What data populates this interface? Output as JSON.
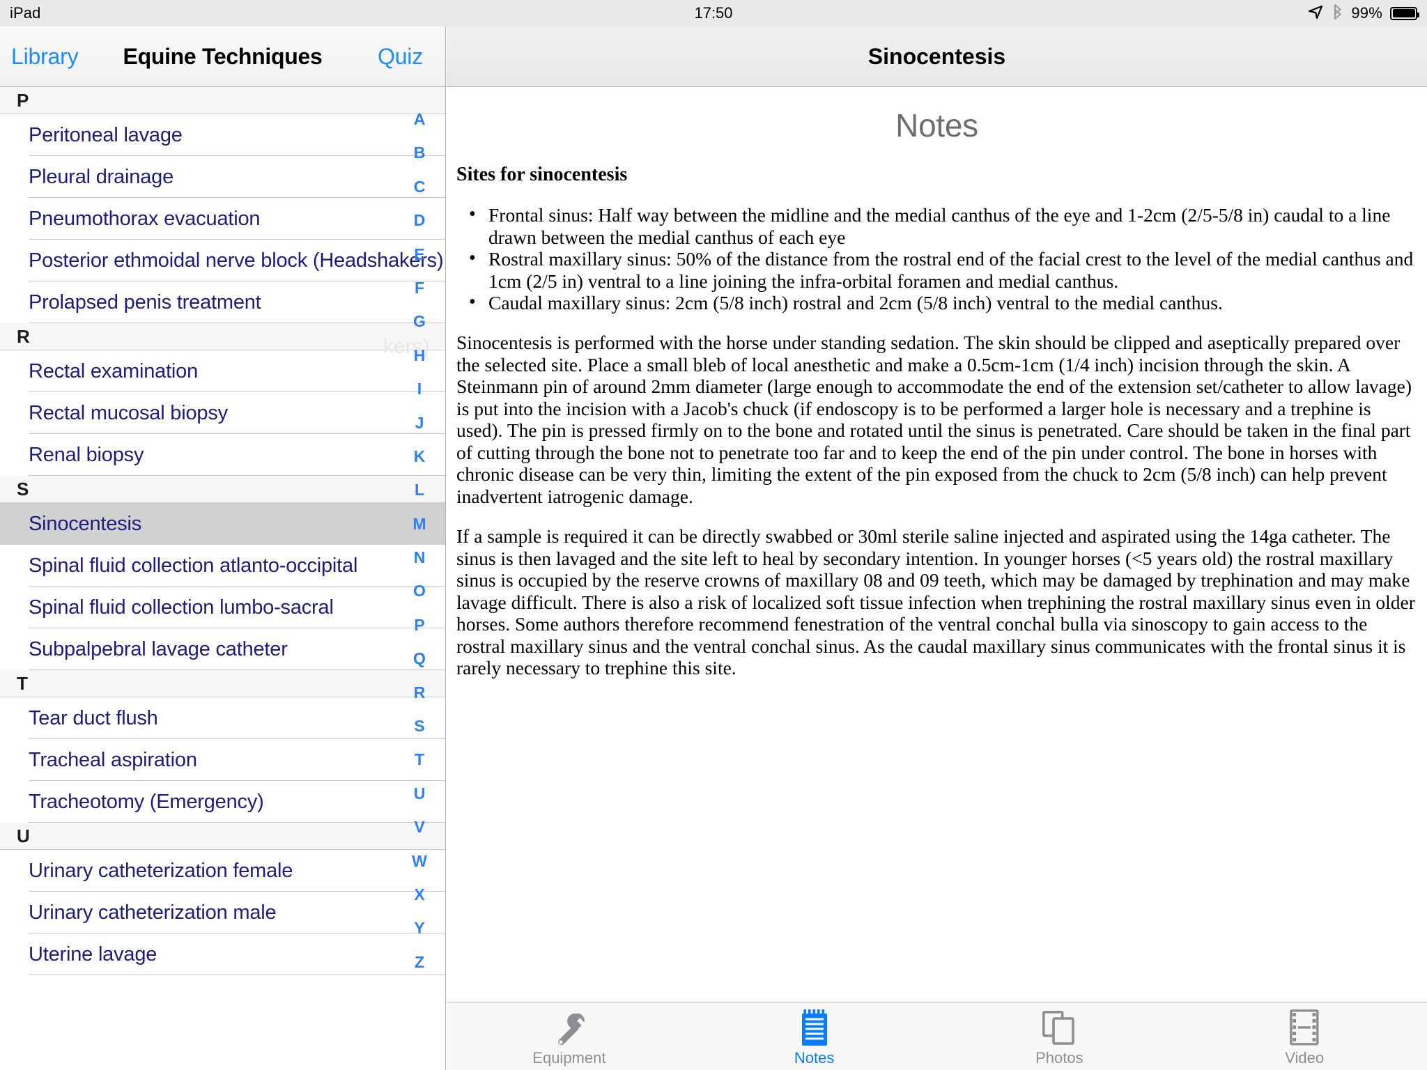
{
  "status_bar": {
    "device_label": "iPad",
    "time": "17:50",
    "battery_percent": "99%",
    "icons": [
      "location-arrow-icon",
      "bluetooth-icon",
      "battery-icon"
    ]
  },
  "master": {
    "back_label": "Library",
    "title": "Equine Techniques",
    "quiz_label": "Quiz",
    "sections": [
      {
        "letter": "P",
        "items": [
          "Peritoneal lavage",
          "Pleural drainage",
          "Pneumothorax evacuation",
          "Posterior ethmoidal nerve block (Headshakers)",
          "Prolapsed penis treatment"
        ]
      },
      {
        "letter": "R",
        "items": [
          "Rectal examination",
          "Rectal mucosal biopsy",
          "Renal biopsy"
        ]
      },
      {
        "letter": "S",
        "items": [
          "Sinocentesis",
          "Spinal fluid collection atlanto-occipital",
          "Spinal fluid collection lumbo-sacral",
          "Subpalpebral lavage catheter"
        ]
      },
      {
        "letter": "T",
        "items": [
          "Tear duct flush",
          "Tracheal aspiration",
          "Tracheotomy (Emergency)"
        ]
      },
      {
        "letter": "U",
        "items": [
          "Urinary catheterization female",
          "Urinary catheterization male",
          "Uterine lavage"
        ]
      }
    ],
    "selected_item": "Sinocentesis",
    "alphabet_index": [
      "A",
      "B",
      "C",
      "D",
      "E",
      "F",
      "G",
      "H",
      "I",
      "J",
      "K",
      "L",
      "M",
      "N",
      "O",
      "P",
      "Q",
      "R",
      "S",
      "T",
      "U",
      "V",
      "W",
      "X",
      "Y",
      "Z"
    ],
    "index_color": "#2f7ff0",
    "item_text_color": "#1d1d7a",
    "selected_row_bg": "#d1d1d1",
    "truncated_overflow_text": "kers)"
  },
  "detail": {
    "title": "Sinocentesis",
    "section_heading": "Notes",
    "notes": {
      "heading": "Sites for sinocentesis",
      "bullets": [
        "Frontal sinus: Half way between the midline and the medial canthus of the eye and 1-2cm (2/5-5/8 in) caudal to a line drawn between the medial canthus of each eye",
        "Rostral maxillary sinus: 50% of the distance from the rostral end of the facial crest to the level of the medial canthus and 1cm (2/5 in) ventral to a line joining the infra-orbital foramen and medial canthus.",
        "Caudal maxillary sinus: 2cm (5/8 inch) rostral and 2cm (5/8 inch) ventral to the medial canthus."
      ],
      "paragraphs": [
        "Sinocentesis is performed with the horse under standing sedation. The skin should be clipped and aseptically prepared over the selected site. Place a small bleb of local anesthetic and make a 0.5cm-1cm (1/4 inch) incision through the skin. A Steinmann pin of around 2mm diameter (large enough to accommodate the end of the extension set/catheter to allow lavage) is put into the incision with a Jacob's chuck (if endoscopy is to be performed a larger hole is necessary and a trephine is used). The pin is pressed firmly on to the bone and rotated until the sinus is penetrated. Care should be taken in the final part of cutting through the bone not to penetrate too far and to keep the end of the pin under control. The bone in horses with chronic disease can be very thin, limiting the extent of the pin exposed from the chuck to 2cm (5/8 inch) can help prevent inadvertent iatrogenic damage.",
        "If a sample is required it can be directly swabbed or 30ml sterile saline injected and aspirated using the 14ga catheter. The sinus is then lavaged and the site left to heal by secondary intention. In younger horses (<5 years old) the rostral maxillary sinus is occupied by the reserve crowns of maxillary 08 and 09 teeth, which may be damaged by trephination and may make lavage difficult. There is also a risk of localized soft tissue infection when trephining the rostral maxillary sinus even in older horses. Some authors therefore recommend fenestration of the ventral conchal bulla via sinoscopy to gain access to the rostral maxillary sinus and the ventral conchal sinus. As the caudal maxillary sinus communicates with the frontal sinus it is rarely necessary to trephine this site."
      ]
    }
  },
  "tab_bar": {
    "active": "Notes",
    "active_color": "#0a7cff",
    "inactive_color": "#8e8e93",
    "tabs": [
      {
        "label": "Equipment",
        "icon": "wrench-icon"
      },
      {
        "label": "Notes",
        "icon": "notepad-icon"
      },
      {
        "label": "Photos",
        "icon": "photos-icon"
      },
      {
        "label": "Video",
        "icon": "film-strip-icon"
      }
    ]
  }
}
